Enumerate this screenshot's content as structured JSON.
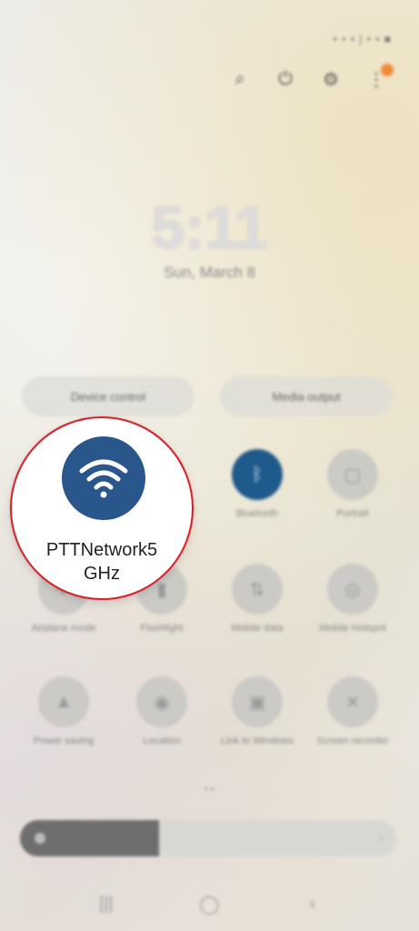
{
  "status_bar": {
    "text": "• • • | • • ■"
  },
  "top_icons": [
    {
      "name": "search-icon",
      "glyph": "⌕"
    },
    {
      "name": "power-icon",
      "glyph": "⏻"
    },
    {
      "name": "settings-icon",
      "glyph": "⚙"
    },
    {
      "name": "more-options-icon",
      "glyph": "⋮"
    }
  ],
  "lock": {
    "time": "5:11",
    "date": "Sun, March 8"
  },
  "pills": {
    "left": "Device control",
    "right": "Media output"
  },
  "tiles": [
    {
      "name": "tile-bluetooth",
      "label": "Bluetooth",
      "glyph": "ᛒ",
      "active": true
    },
    {
      "name": "tile-portrait",
      "label": "Portrait",
      "glyph": "▢",
      "active": false
    },
    {
      "name": "tile-airplane-mode",
      "label": "Airplane mode",
      "glyph": "✈",
      "active": false
    },
    {
      "name": "tile-flashlight",
      "label": "Flashlight",
      "glyph": "▮",
      "active": false
    },
    {
      "name": "tile-mobile-data",
      "label": "Mobile data",
      "glyph": "⇅",
      "active": false
    },
    {
      "name": "tile-mobile-hotspot",
      "label": "Mobile Hotspot",
      "glyph": "◎",
      "active": false
    },
    {
      "name": "tile-power-saving",
      "label": "Power saving",
      "glyph": "▲",
      "active": false
    },
    {
      "name": "tile-location",
      "label": "Location",
      "glyph": "◉",
      "active": false
    },
    {
      "name": "tile-link-to-windows",
      "label": "Link to Windows",
      "glyph": "▣",
      "active": false
    },
    {
      "name": "tile-screen-recorder",
      "label": "Screen recorder",
      "glyph": "✕",
      "active": false
    }
  ],
  "page_indicator": "• •",
  "brightness": {
    "level_percent": 37,
    "chevron": "›"
  },
  "nav": [
    {
      "name": "recent-apps-icon",
      "glyph": "|||"
    },
    {
      "name": "home-icon",
      "glyph": "◯"
    },
    {
      "name": "back-icon",
      "glyph": "‹"
    }
  ],
  "highlight": {
    "label_line1": "PTTNetwork5",
    "label_line2": "GHz"
  }
}
